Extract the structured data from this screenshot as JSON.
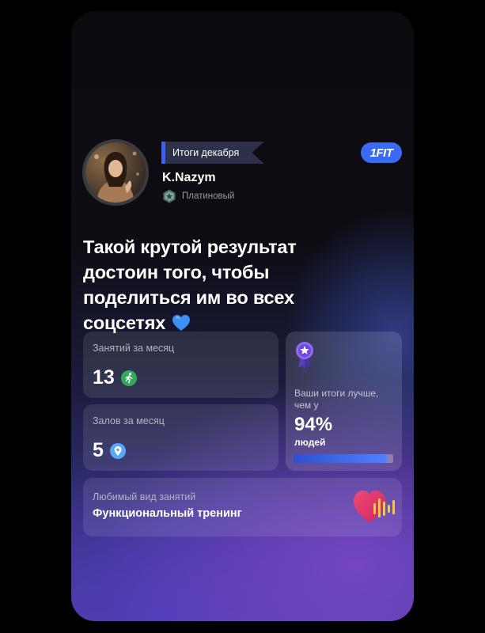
{
  "header": {
    "month_tag": "Итоги декабря",
    "brand_logo": "1FIT"
  },
  "user": {
    "name": "K.Nazym",
    "tier": "Платиновый",
    "tier_icon": "star-badge-icon"
  },
  "headline": "Такой крутой результат достоин того, чтобы поделиться им во всех соцсетях",
  "stats": {
    "sessions": {
      "label": "Занятий за месяц",
      "value": "13",
      "icon": "running-person-icon"
    },
    "gyms": {
      "label": "Залов за месяц",
      "value": "5",
      "icon": "location-pin-icon"
    }
  },
  "comparison": {
    "icon": "medal-icon",
    "label": "Ваши итоги лучше, чем у",
    "percent": "94%",
    "people": "людей",
    "progress": 0.94
  },
  "favorite": {
    "label": "Любимый вид занятий",
    "value": "Функциональный тренинг",
    "icon": "heart-pulse-icon"
  },
  "colors": {
    "accent_blue": "#3a69f2",
    "tag_bar": "#3b63f0",
    "background": "#000000"
  }
}
